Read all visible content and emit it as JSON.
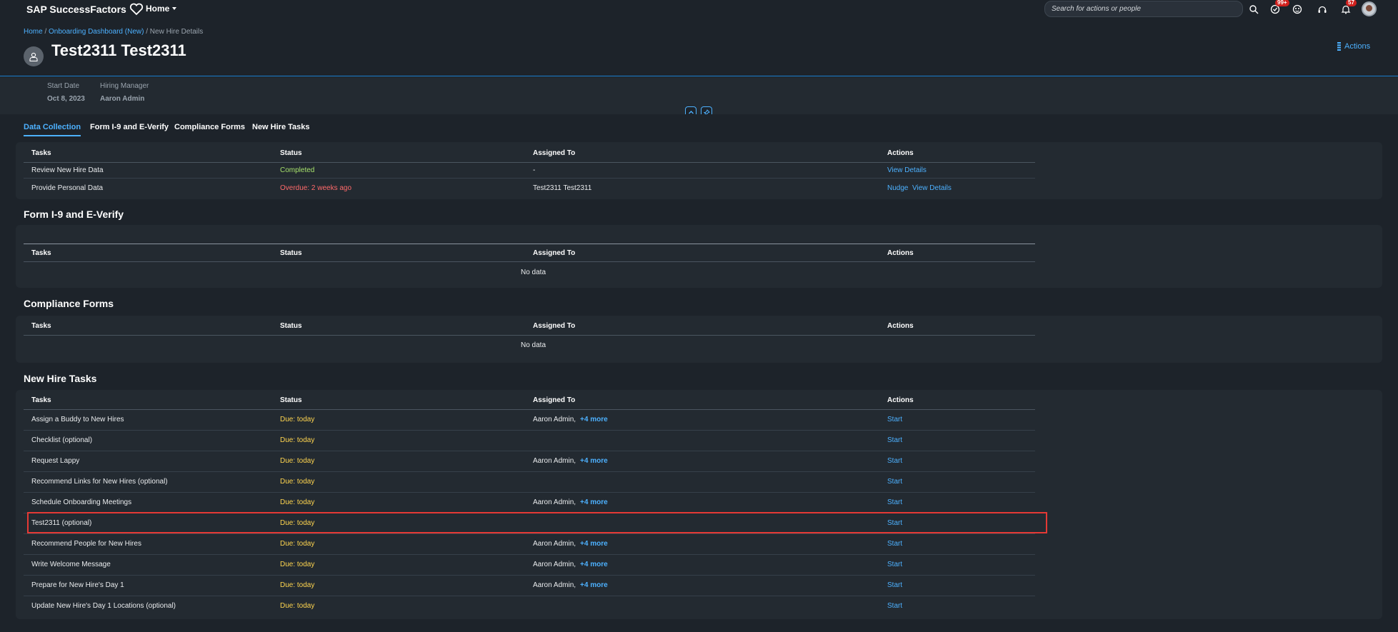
{
  "shell": {
    "brand": "SAP SuccessFactors",
    "home_menu": "Home",
    "search_placeholder": "Search for actions or people",
    "todo_badge": "99+",
    "notif_badge": "57"
  },
  "header": {
    "breadcrumb": {
      "home": "Home",
      "sep1": " / ",
      "dashboard": "Onboarding Dashboard (New)",
      "sep2": " / ",
      "current": "New Hire Details"
    },
    "title": "Test2311 Test2311",
    "actions": "Actions",
    "start_date_label": "Start Date",
    "start_date": "Oct 8, 2023",
    "manager_label": "Hiring Manager",
    "manager": "Aaron Admin"
  },
  "tabs": [
    "Data Collection",
    "Form I-9 and E-Verify",
    "Compliance Forms",
    "New Hire Tasks"
  ],
  "columns": [
    "Tasks",
    "Status",
    "Assigned To",
    "Actions"
  ],
  "data_collection": {
    "rows": [
      {
        "task": "Review New Hire Data",
        "status": "Completed",
        "assigned": "-",
        "action1": "View Details",
        "action2": ""
      },
      {
        "task": "Provide Personal Data",
        "status": "Overdue: 2 weeks ago",
        "assigned": "Test2311 Test2311",
        "action1": "Nudge",
        "action2": "View Details"
      }
    ]
  },
  "i9": {
    "title": "Form I-9 and E-Verify",
    "no_data": "No data"
  },
  "compliance": {
    "title": "Compliance Forms",
    "no_data": "No data"
  },
  "new_hire_tasks": {
    "title": "New Hire Tasks",
    "rows": [
      {
        "task": "Assign a Buddy to New Hires",
        "status": "Due: today",
        "assigned": "Aaron Admin,",
        "more": "+4 more",
        "action": "Start"
      },
      {
        "task": "Checklist (optional)",
        "status": "Due: today",
        "assigned": "",
        "more": "",
        "action": "Start"
      },
      {
        "task": "Request Lappy",
        "status": "Due: today",
        "assigned": "Aaron Admin,",
        "more": "+4 more",
        "action": "Start"
      },
      {
        "task": "Recommend Links for New Hires (optional)",
        "status": "Due: today",
        "assigned": "",
        "more": "",
        "action": "Start"
      },
      {
        "task": "Schedule Onboarding Meetings",
        "status": "Due: today",
        "assigned": "Aaron Admin,",
        "more": "+4 more",
        "action": "Start"
      },
      {
        "task": "Test2311 (optional)",
        "status": "Due: today",
        "assigned": "",
        "more": "",
        "action": "Start"
      },
      {
        "task": "Recommend People for New Hires",
        "status": "Due: today",
        "assigned": "Aaron Admin,",
        "more": "+4 more",
        "action": "Start"
      },
      {
        "task": "Write Welcome Message",
        "status": "Due: today",
        "assigned": "Aaron Admin,",
        "more": "+4 more",
        "action": "Start"
      },
      {
        "task": "Prepare for New Hire's Day 1",
        "status": "Due: today",
        "assigned": "Aaron Admin,",
        "more": "+4 more",
        "action": "Start"
      },
      {
        "task": "Update New Hire's Day 1 Locations (optional)",
        "status": "Due: today",
        "assigned": "",
        "more": "",
        "action": "Start"
      }
    ]
  },
  "colors": {
    "accent": "#4db1ff",
    "completed": "#a6e06b",
    "overdue": "#ff6a6a",
    "due": "#ffd54f",
    "highlight": "#e53935"
  },
  "icons": [
    "heart-icon",
    "search-icon",
    "todo-icon",
    "assistant-icon",
    "help-icon",
    "bell-icon",
    "user-icon",
    "actions-icon",
    "collapse-icon",
    "pin-icon"
  ]
}
